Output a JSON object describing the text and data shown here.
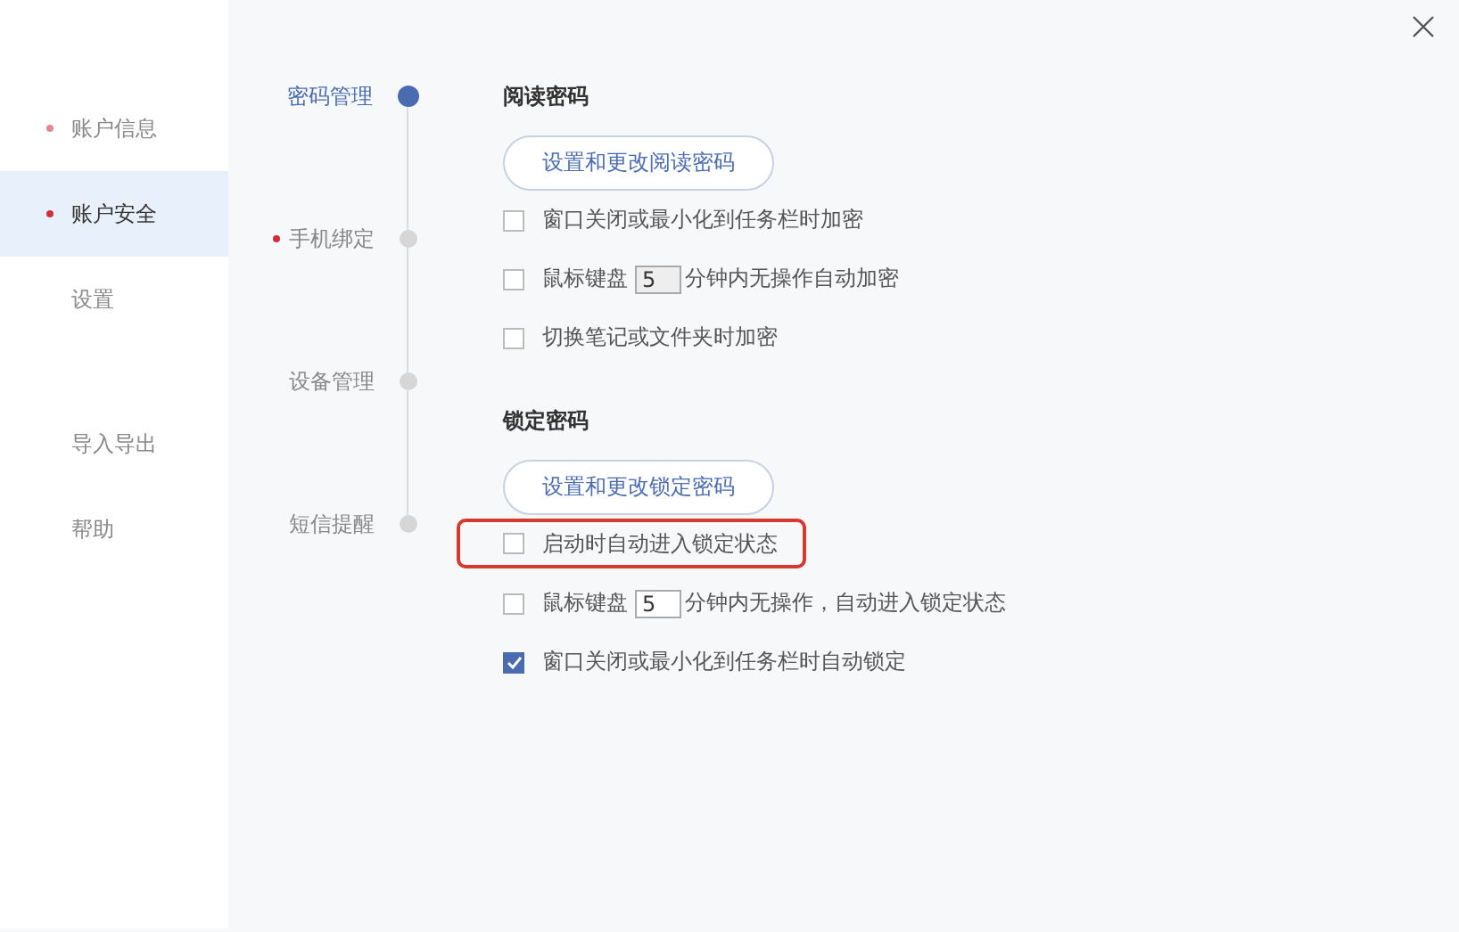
{
  "sidebar": {
    "items": [
      {
        "label": "账户信息",
        "dot": true,
        "selected": false
      },
      {
        "label": "账户安全",
        "dot": true,
        "selected": true
      },
      {
        "label": "设置",
        "dot": false,
        "selected": false
      },
      {
        "label": "导入导出",
        "dot": false,
        "selected": false
      },
      {
        "label": "帮助",
        "dot": false,
        "selected": false
      }
    ]
  },
  "steps": [
    {
      "label": "密码管理",
      "dot": false,
      "selected": true
    },
    {
      "label": "手机绑定",
      "dot": true,
      "selected": false
    },
    {
      "label": "设备管理",
      "dot": false,
      "selected": false
    },
    {
      "label": "短信提醒",
      "dot": false,
      "selected": false
    }
  ],
  "sections": [
    {
      "title": "阅读密码",
      "button": "设置和更改阅读密码",
      "options": [
        {
          "kind": "check",
          "label": "窗口关闭或最小化到任务栏时加密",
          "checked": false,
          "highlighted": false
        },
        {
          "kind": "minutes",
          "prefix": "鼠标键盘",
          "value": "5",
          "suffix": "分钟内无操作自动加密",
          "checked": false,
          "disabled": true,
          "highlighted": false
        },
        {
          "kind": "check",
          "label": "切换笔记或文件夹时加密",
          "checked": false,
          "highlighted": false
        }
      ]
    },
    {
      "title": "锁定密码",
      "button": "设置和更改锁定密码",
      "options": [
        {
          "kind": "check",
          "label": "启动时自动进入锁定状态",
          "checked": false,
          "highlighted": true
        },
        {
          "kind": "minutes",
          "prefix": "鼠标键盘",
          "value": "5",
          "suffix": "分钟内无操作，自动进入锁定状态",
          "checked": false,
          "disabled": false,
          "highlighted": false
        },
        {
          "kind": "check",
          "label": "窗口关闭或最小化到任务栏时自动锁定",
          "checked": true,
          "highlighted": false
        }
      ]
    }
  ]
}
